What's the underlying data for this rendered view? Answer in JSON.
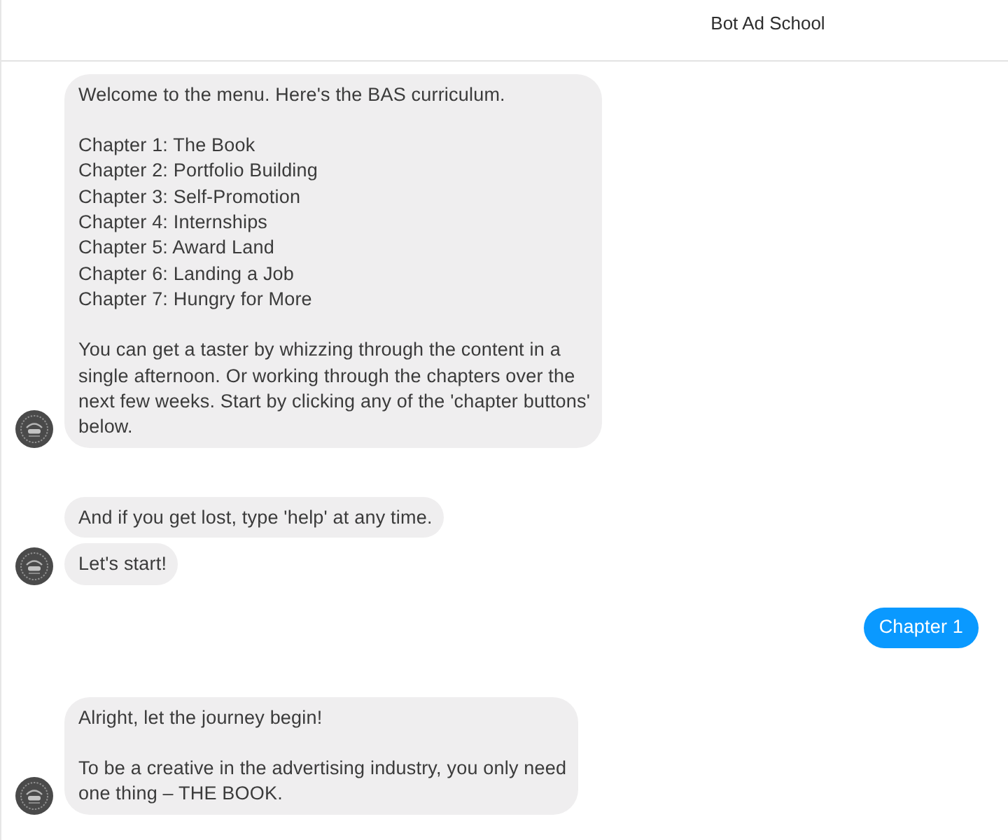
{
  "header": {
    "title": "Bot Ad School"
  },
  "messages": [
    {
      "kind": "bot",
      "bubbles": [
        {
          "paragraphs": [
            [
              "Welcome to the menu. Here's the BAS curriculum."
            ],
            [
              "Chapter 1: The Book",
              "Chapter 2: Portfolio Building",
              "Chapter 3: Self-Promotion",
              "Chapter 4: Internships",
              "Chapter 5: Award Land",
              "Chapter 6: Landing a Job",
              "Chapter 7: Hungry for More"
            ],
            [
              "You can get a taster by whizzing through the content in a\nsingle afternoon. Or working through the chapters over the\nnext few weeks. Start by clicking any of the 'chapter buttons'\nbelow."
            ]
          ]
        }
      ]
    },
    {
      "kind": "bot",
      "bubbles": [
        {
          "paragraphs": [
            [
              "And if you get lost, type 'help' at any time."
            ]
          ]
        },
        {
          "paragraphs": [
            [
              "Let's start!"
            ]
          ]
        }
      ]
    },
    {
      "kind": "user",
      "bubbles": [
        {
          "paragraphs": [
            [
              "Chapter 1"
            ]
          ]
        }
      ]
    },
    {
      "kind": "bot",
      "bubbles": [
        {
          "paragraphs": [
            [
              "Alright, let the journey begin!"
            ],
            [
              "To be a creative in the advertising industry, you only need\none thing – THE BOOK."
            ]
          ]
        }
      ]
    }
  ]
}
